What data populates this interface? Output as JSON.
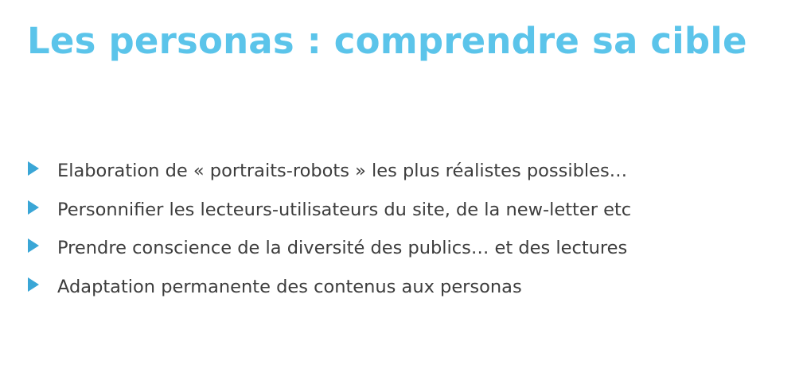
{
  "slide": {
    "title": "Les personas : comprendre sa cible",
    "bullets": [
      {
        "text": "Elaboration de « portraits-robots » les plus réalistes possibles…"
      },
      {
        "text": "Personnifier les lecteurs-utilisateurs du site, de la new-letter etc"
      },
      {
        "text": "Prendre conscience de la diversité des publics… et des lectures"
      },
      {
        "text": "Adaptation permanente des contenus aux personas"
      }
    ]
  },
  "colors": {
    "title": "#5bc4ea",
    "bullet_marker": "#3aa6d6",
    "body_text": "#3d3d3d",
    "background": "#ffffff"
  },
  "icons": {
    "bullet_marker": "triangle-right-icon"
  }
}
